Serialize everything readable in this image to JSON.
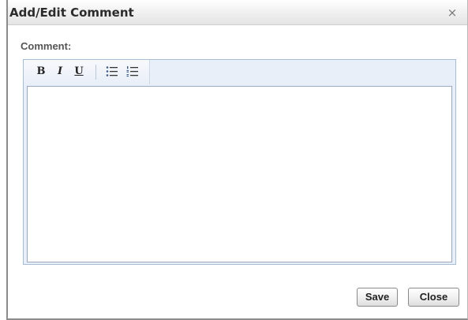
{
  "dialog": {
    "title": "Add/Edit Comment",
    "close_glyph": "×",
    "close_icon": "close-icon"
  },
  "form": {
    "comment_label": "Comment:",
    "comment_value": "",
    "toolbar": {
      "bold_label": "B",
      "italic_label": "I",
      "underline_label": "U",
      "bullet_list_icon": "bulleted-list-icon",
      "numbered_list_icon": "numbered-list-icon"
    }
  },
  "buttons": {
    "save_label": "Save",
    "close_label": "Close"
  },
  "colors": {
    "toolbar_bg": "#e9eff8",
    "editor_border": "#a7bdd5",
    "title_text": "#2b2b2b"
  }
}
